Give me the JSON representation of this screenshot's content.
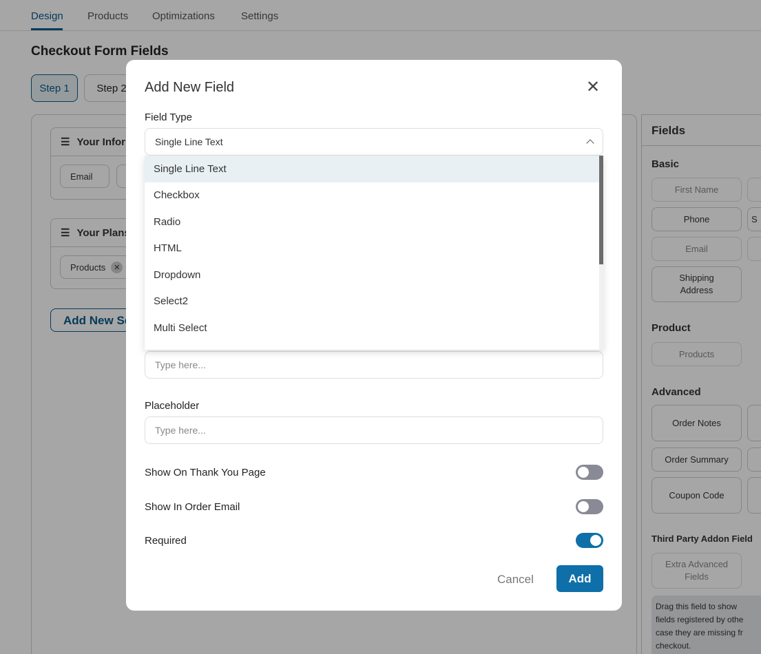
{
  "tabs": [
    {
      "label": "Design",
      "active": true
    },
    {
      "label": "Products"
    },
    {
      "label": "Optimizations"
    },
    {
      "label": "Settings"
    }
  ],
  "page_title": "Checkout Form Fields",
  "steps": [
    "Step 1",
    "Step 2"
  ],
  "sections": [
    {
      "title": "Your Inform",
      "chips": [
        "Email"
      ]
    },
    {
      "title": "Your Plans",
      "chips": [
        "Products"
      ]
    }
  ],
  "add_section_label": "Add New Se",
  "fields_panel": {
    "title": "Fields",
    "basic": {
      "title": "Basic",
      "items": [
        "First Name",
        "Phone",
        "Email",
        "Shipping Address"
      ],
      "partial": "S"
    },
    "product": {
      "title": "Product",
      "items": [
        "Products"
      ]
    },
    "advanced": {
      "title": "Advanced",
      "items": [
        "Order Notes",
        "Order Summary",
        "Coupon Code"
      ]
    },
    "third_party": {
      "title": "Third Party Addon Field",
      "items": [
        "Extra Advanced Fields"
      ],
      "note_lines": [
        "Drag this field to show",
        "fields registered by othe",
        "case they are missing fr",
        "checkout."
      ]
    }
  },
  "modal": {
    "title": "Add New Field",
    "field_type_label": "Field Type",
    "field_type_value": "Single Line Text",
    "options": [
      "Single Line Text",
      "Checkbox",
      "Radio",
      "HTML",
      "Dropdown",
      "Select2",
      "Multi Select"
    ],
    "label_input_placeholder": "Type here...",
    "placeholder_label": "Placeholder",
    "placeholder_input_placeholder": "Type here...",
    "toggles": [
      {
        "label": "Show On Thank You Page",
        "on": false
      },
      {
        "label": "Show In Order Email",
        "on": false
      },
      {
        "label": "Required",
        "on": true
      }
    ],
    "cancel": "Cancel",
    "add": "Add"
  },
  "colors": {
    "accent": "#0f6fa8",
    "toggle_off": "#8a8a96"
  }
}
